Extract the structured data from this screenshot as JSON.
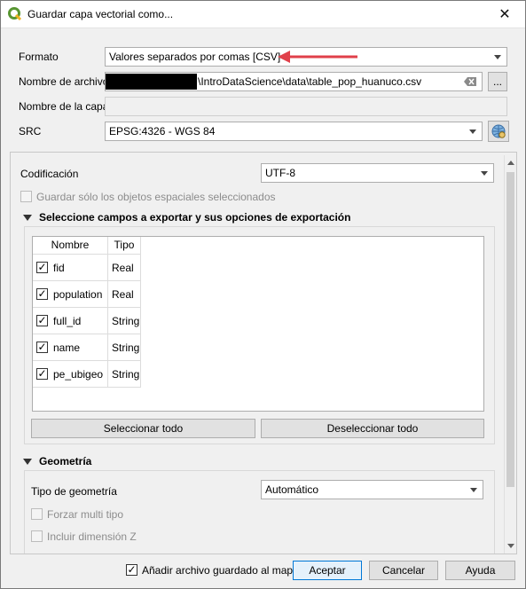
{
  "window": {
    "title": "Guardar capa vectorial como..."
  },
  "form": {
    "format_label": "Formato",
    "format_value": "Valores separados por comas [CSV]",
    "filename_label": "Nombre de archivo",
    "filename_value": "\\IntroDataScience\\data\\table_pop_huanuco.csv",
    "browse_label": "...",
    "layername_label": "Nombre de la capa",
    "layername_value": "",
    "src_label": "SRC",
    "src_value": "EPSG:4326 - WGS 84"
  },
  "options": {
    "encoding_label": "Codificación",
    "encoding_value": "UTF-8",
    "selected_only_label": "Guardar sólo los objetos espaciales seleccionados",
    "fields_group_title": "Seleccione campos a exportar y sus opciones de exportación",
    "columns": [
      "Nombre",
      "Tipo"
    ],
    "fields": [
      {
        "name": "fid",
        "type": "Real",
        "checked": true
      },
      {
        "name": "population",
        "type": "Real",
        "checked": true
      },
      {
        "name": "full_id",
        "type": "String",
        "checked": true
      },
      {
        "name": "name",
        "type": "String",
        "checked": true
      },
      {
        "name": "pe_ubigeo",
        "type": "String",
        "checked": true
      }
    ],
    "select_all_label": "Seleccionar todo",
    "deselect_all_label": "Deseleccionar todo",
    "geometry_group_title": "Geometría",
    "geometry_type_label": "Tipo de geometría",
    "geometry_type_value": "Automático",
    "force_multi_label": "Forzar multi tipo",
    "include_z_label": "Incluir dimensión Z"
  },
  "footer": {
    "add_to_map_label": "Añadir archivo guardado al mapa",
    "ok_label": "Aceptar",
    "cancel_label": "Cancelar",
    "help_label": "Ayuda"
  },
  "colors": {
    "annotation_arrow": "#e0404a",
    "accent": "#0078d7"
  }
}
